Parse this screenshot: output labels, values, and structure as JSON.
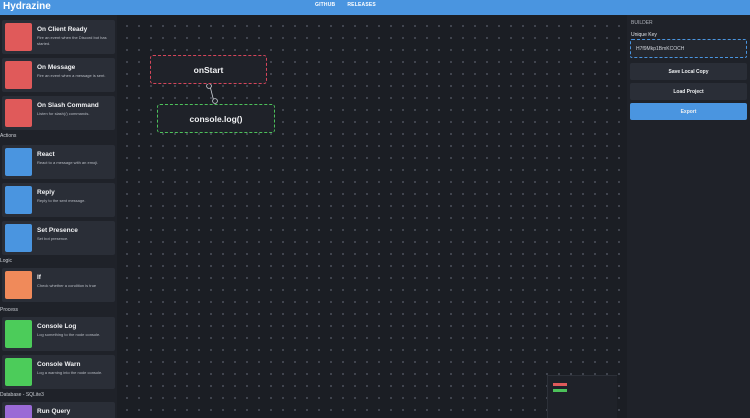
{
  "app": {
    "title": "Hydrazine"
  },
  "nav": {
    "github": "GITHUB",
    "releases": "RELEASES"
  },
  "sidebar": {
    "events": [
      {
        "title": "On Client Ready",
        "desc": "Fire an event when the Discord bot has started.",
        "color": "#e05a5a"
      },
      {
        "title": "On Message",
        "desc": "Fire an event when a message is sent.",
        "color": "#e05a5a"
      },
      {
        "title": "On Slash Command",
        "desc": "Listen for slash(/) commands.",
        "color": "#e05a5a"
      }
    ],
    "sections": {
      "actions": "Actions",
      "logic": "Logic",
      "process": "Process",
      "database": "Database - SQLite3"
    },
    "actions": [
      {
        "title": "React",
        "desc": "React to a message with an emoji.",
        "color": "#4a95e0"
      },
      {
        "title": "Reply",
        "desc": "Reply to the sent message.",
        "color": "#4a95e0"
      },
      {
        "title": "Set Presence",
        "desc": "Set bot presence.",
        "color": "#4a95e0"
      }
    ],
    "logic": [
      {
        "title": "If",
        "desc": "Check whether a condition is true",
        "color": "#f08a5a"
      }
    ],
    "process": [
      {
        "title": "Console Log",
        "desc": "Log something to the node console.",
        "color": "#4ccc5a"
      },
      {
        "title": "Console Warn",
        "desc": "Log a warning into the node console.",
        "color": "#4ccc5a"
      }
    ],
    "database": [
      {
        "title": "Run Query",
        "desc": "",
        "color": "#9a6ad6"
      }
    ]
  },
  "canvas": {
    "nodes": {
      "event": "onStart",
      "action": "console.log()"
    },
    "colors": {
      "event_border": "#d6455a",
      "action_border": "#4cc25a"
    }
  },
  "builder": {
    "header": "BUILDER",
    "key_label": "Unique Key",
    "key_value": "H7f9Mkp1BmKCOCH",
    "save_label": "Save Local Copy",
    "load_label": "Load Project",
    "export_label": "Export"
  },
  "colors": {
    "accent": "#4a95e0",
    "background": "#1c1f26"
  }
}
